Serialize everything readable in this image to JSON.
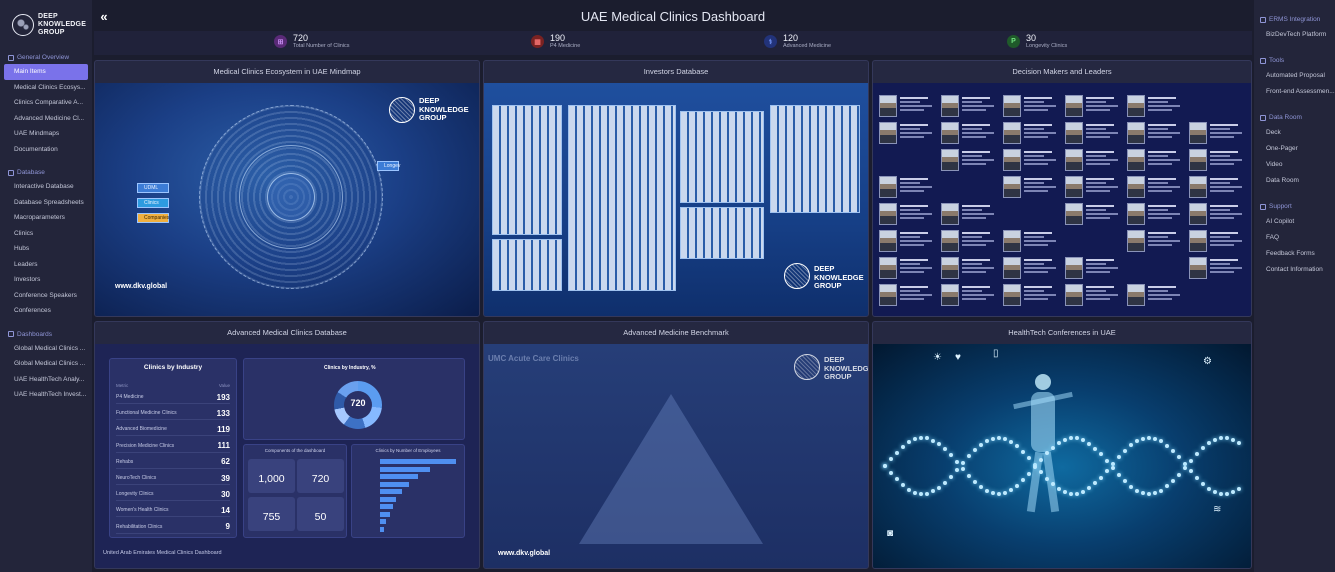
{
  "brand": {
    "line1": "DEEP",
    "line2": "KNOWLEDGE",
    "line3": "GROUP"
  },
  "header": {
    "title": "UAE Medical Clinics Dashboard",
    "collapse_icon": "«"
  },
  "kpis": [
    {
      "value": "720",
      "label": "Total Number of Clinics",
      "color": "#a23ec9",
      "icon": "clinic-icon"
    },
    {
      "value": "190",
      "label": "P4 Medicine",
      "color": "#d63a3a",
      "icon": "p4-icon"
    },
    {
      "value": "120",
      "label": "Advanced Medicine",
      "color": "#3a5fd6",
      "icon": "medicine-icon"
    },
    {
      "value": "30",
      "label": "Longevity Clinics",
      "color": "#3aa84e",
      "icon": "longevity-icon"
    }
  ],
  "sidebar": {
    "general": {
      "heading": "General Overview",
      "items": [
        "Main Items",
        "Medical Clinics Ecosys...",
        "Clinics Comparative A...",
        "Advanced Medicine Cl...",
        "UAE Mindmaps",
        "Documentation"
      ]
    },
    "database": {
      "heading": "Database",
      "items": [
        "Interactive Database",
        "Database Spreadsheets",
        "Macroparameters",
        "Clinics",
        "Hubs",
        "Leaders",
        "Investors",
        "Conference Speakers",
        "Conferences"
      ]
    },
    "dashboards": {
      "heading": "Dashboards",
      "items": [
        "Global Medical Clinics ...",
        "Global Medical Clinics ...",
        "UAE HealthTech Analy...",
        "UAE HealthTech Invest..."
      ]
    }
  },
  "rsidebar": {
    "sections": [
      {
        "heading": "ERMS Integration",
        "items": [
          "BizDevTech Platform"
        ]
      },
      {
        "heading": "Tools",
        "items": [
          "Automated Proposal",
          "Front-end Assessmen..."
        ]
      },
      {
        "heading": "Data Room",
        "items": [
          "Deck",
          "One-Pager",
          "Video",
          "Data Room"
        ]
      },
      {
        "heading": "Support",
        "items": [
          "AI Copilot",
          "FAQ",
          "Feedback Forms",
          "Contact Information"
        ]
      }
    ]
  },
  "panels": {
    "mindmap": {
      "title": "Medical Clinics Ecosystem in UAE Mindmap",
      "tags": [
        "UDML",
        "Clinics",
        "Companies",
        "Longev"
      ],
      "site": "www.dkv.global"
    },
    "investors": {
      "title": "Investors Database"
    },
    "leaders": {
      "title": "Decision Makers and Leaders"
    },
    "advdb": {
      "title": "Advanced Medical Clinics Database",
      "card_title": "Clinics by Industry",
      "col_metric": "Metric",
      "col_value": "Value",
      "rows": [
        {
          "label": "P4 Medicine",
          "value": "193"
        },
        {
          "label": "Functional Medicine Clinics",
          "value": "133"
        },
        {
          "label": "Advanced Biomedicine",
          "value": "119"
        },
        {
          "label": "Precision Medicine Clinics",
          "value": "111"
        },
        {
          "label": "Rehabs",
          "value": "62"
        },
        {
          "label": "NeuroTech Clinics",
          "value": "39"
        },
        {
          "label": "Longevity Clinics",
          "value": "30"
        },
        {
          "label": "Women's Health Clinics",
          "value": "14"
        },
        {
          "label": "Rehabilitation Clinics",
          "value": "9"
        }
      ],
      "donut_title": "Clinics by Industry, %",
      "donut_total": "720",
      "donut_total_label": "Total",
      "components_title": "Components of the dashboard",
      "stats": [
        "1,000",
        "720",
        "755",
        "50"
      ],
      "employees_title": "Clinics by Number of Employees",
      "footer": "United Arab Emirates Medical Clinics Dashboard"
    },
    "bench": {
      "title": "Advanced Medicine Benchmark",
      "heading": "UMC Acute Care Clinics",
      "site": "www.dkv.global"
    },
    "health": {
      "title": "HealthTech Conferences in UAE"
    }
  }
}
